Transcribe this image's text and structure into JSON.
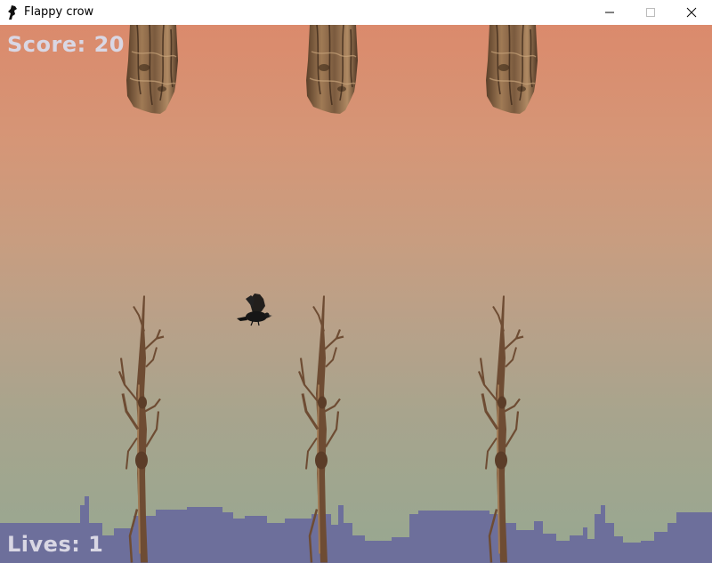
{
  "window": {
    "title": "Flappy crow",
    "app_icon": "crow-icon",
    "controls": [
      "minimize-icon",
      "maximize-icon",
      "close-icon"
    ]
  },
  "hud": {
    "score": "Score: 20",
    "lives": "Lives: 1"
  },
  "scene": {
    "colors": {
      "sky_top": "#db8a6c",
      "sky_bottom": "#97a891",
      "skyline": "#6a6c9c",
      "hud_text": "#d9d7e4",
      "crow": "#1b1b1b",
      "trunk": "#7a5a3e"
    },
    "sprites": [
      "hanging-trunk-obstacle",
      "dead-tree-obstacle",
      "crow-player",
      "city-skyline"
    ]
  }
}
